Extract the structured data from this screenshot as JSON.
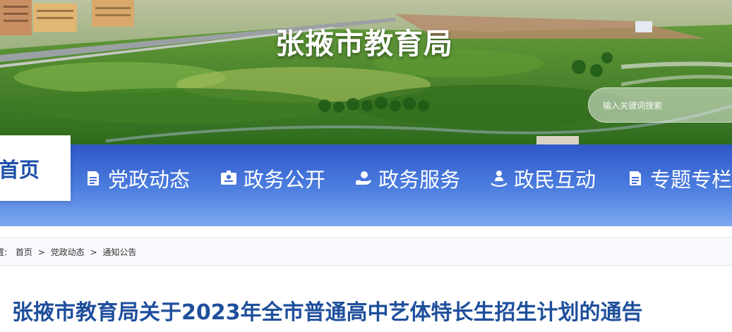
{
  "header": {
    "site_title": "张掖市教育局",
    "search_placeholder": "输入关键词搜索"
  },
  "nav": {
    "home_label": "首页",
    "items": [
      {
        "label": "党政动态",
        "icon": "document-icon"
      },
      {
        "label": "政务公开",
        "icon": "id-card-icon"
      },
      {
        "label": "政务服务",
        "icon": "hand-service-icon"
      },
      {
        "label": "政民互动",
        "icon": "person-interaction-icon"
      },
      {
        "label": "专题专栏",
        "icon": "document-icon"
      }
    ]
  },
  "breadcrumb": {
    "prefix": "置:",
    "items": [
      "首页",
      "党政动态",
      "通知公告"
    ],
    "separator": ">"
  },
  "article": {
    "title": "张掖市教育局关于2023年全市普通高中艺体特长生招生计划的通告"
  },
  "colors": {
    "nav_top": "#2f57c8",
    "nav_bottom": "#7da8f0",
    "title_blue": "#1f4f9c",
    "home_text": "#1d4fa8"
  }
}
